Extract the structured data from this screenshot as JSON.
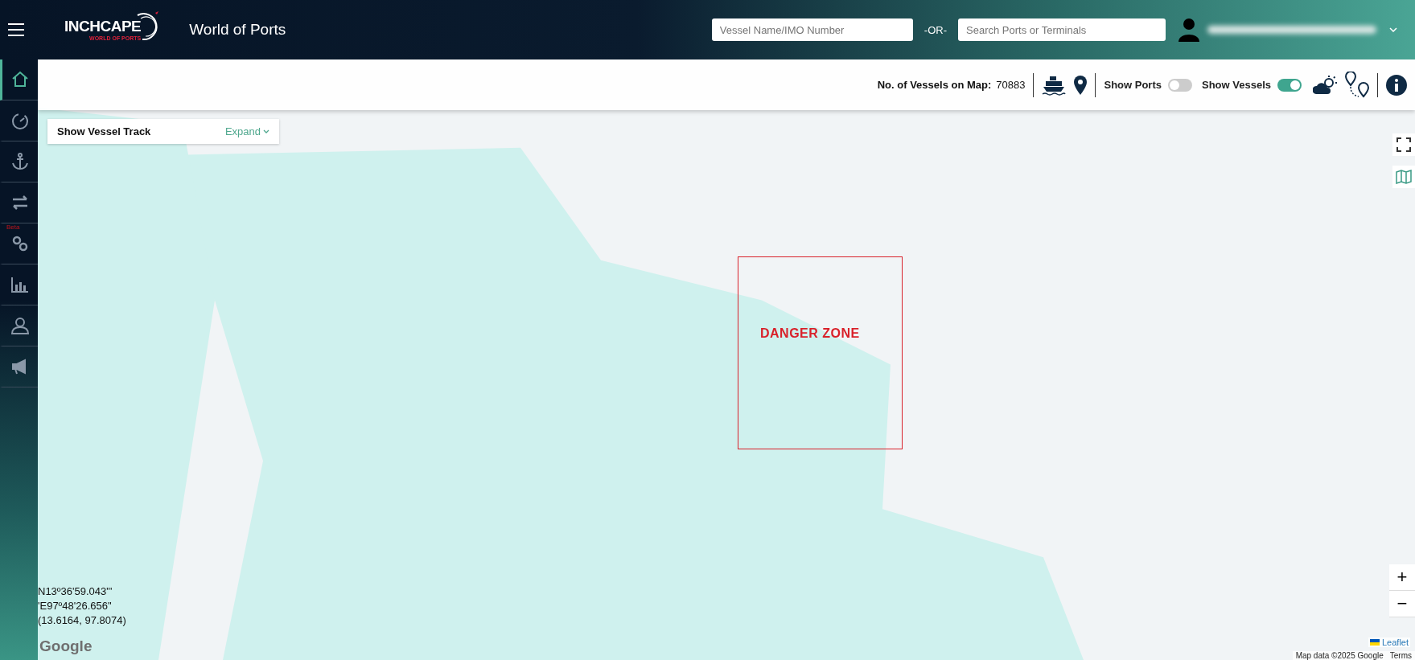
{
  "header": {
    "logo_text": "INCHCAPE",
    "logo_subtext": "WORLD OF PORTS",
    "title": "World of Ports",
    "vessel_search": {
      "placeholder": "Vessel Name/IMO Number"
    },
    "separator": "-OR-",
    "port_search": {
      "placeholder": "Search Ports or Terminals"
    }
  },
  "sidebar": {
    "items": [
      {
        "selected": true
      },
      {
        "selected": false
      },
      {
        "selected": false
      },
      {
        "selected": false
      },
      {
        "selected": false,
        "badge": "Beta"
      },
      {
        "selected": false
      },
      {
        "selected": false
      },
      {
        "selected": false
      }
    ]
  },
  "toolbar": {
    "vessel_count_label": "No. of Vessels on Map:",
    "vessel_count": "70883",
    "toggles": [
      {
        "label": "Show Ports",
        "on": false
      },
      {
        "label": "Show Vessels",
        "on": true
      }
    ]
  },
  "vessel_track": {
    "title": "Show Vessel Track",
    "action": "Expand"
  },
  "map": {
    "zone_label": "DANGER ZONE",
    "coordinates": [
      "N13º36'59.043\"'",
      "'E97º48'26.656\"",
      "(13.6164, 97.8074)"
    ],
    "google_logo": "Google",
    "zoom_in": "+",
    "zoom_out": "−",
    "leaflet": "Leaflet",
    "map_data": "Map data ©2025 Google",
    "terms": "Terms"
  }
}
